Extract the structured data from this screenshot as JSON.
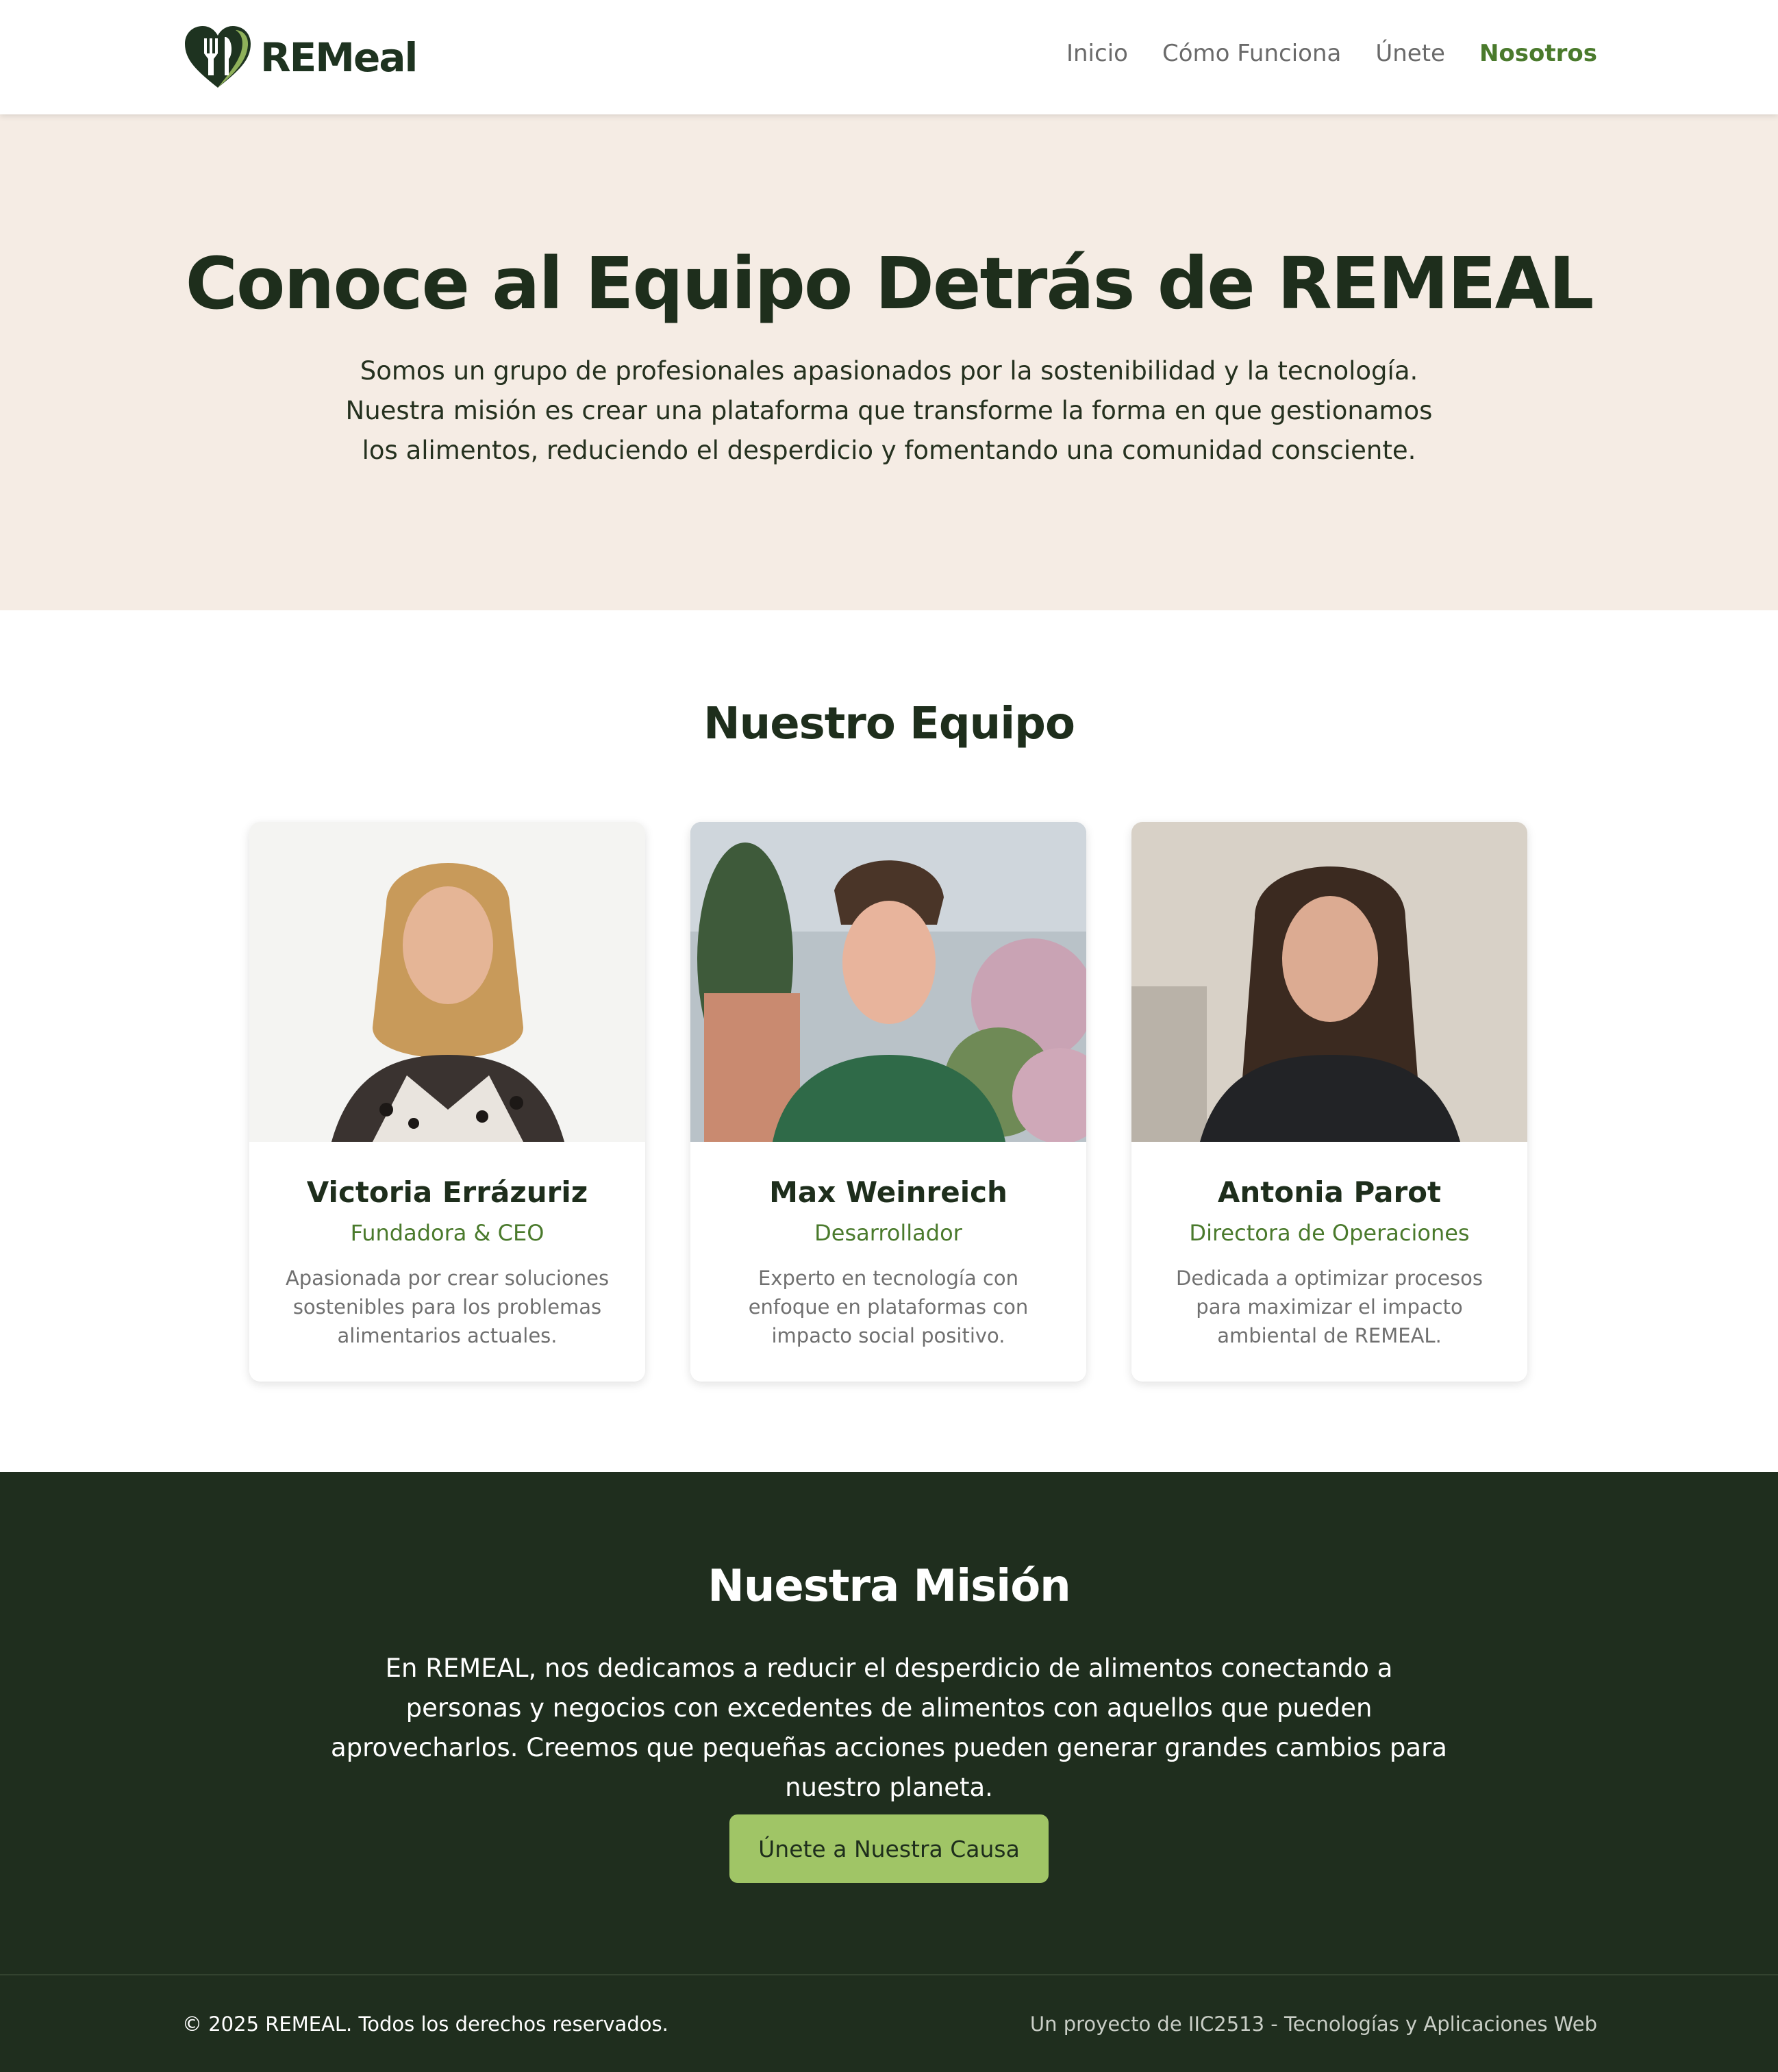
{
  "header": {
    "logo_text": "REMeal",
    "nav": [
      {
        "label": "Inicio"
      },
      {
        "label": "Cómo Funciona"
      },
      {
        "label": "Únete"
      },
      {
        "label": "Nosotros"
      }
    ],
    "active_nav": "Nosotros"
  },
  "hero": {
    "title": "Conoce al Equipo Detrás de REMEAL",
    "text": "Somos un grupo de profesionales apasionados por la sostenibilidad y la tecnología. Nuestra misión es crear una plataforma que transforme la forma en que gestionamos los alimentos, reduciendo el desperdicio y fomentando una comunidad consciente."
  },
  "team": {
    "title": "Nuestro Equipo",
    "members": [
      {
        "name": "Victoria Errázuriz",
        "role": "Fundadora & CEO",
        "description": "Apasionada por crear soluciones sostenibles para los problemas alimentarios actuales."
      },
      {
        "name": "Max Weinreich",
        "role": "Desarrollador",
        "description": "Experto en tecnología con enfoque en plataformas con impacto social positivo."
      },
      {
        "name": "Antonia Parot",
        "role": "Directora de Operaciones",
        "description": "Dedicada a optimizar procesos para maximizar el impacto ambiental de REMEAL."
      }
    ]
  },
  "mission": {
    "title": "Nuestra Misión",
    "text": "En REMEAL, nos dedicamos a reducir el desperdicio de alimentos conectando a personas y negocios con excedentes de alimentos con aquellos que pueden aprovecharlos. Creemos que pequeñas acciones pueden generar grandes cambios para nuestro planeta.",
    "cta_label": "Únete a Nuestra Causa"
  },
  "footer": {
    "copyright": "© 2025 REMEAL. Todos los derechos reservados.",
    "project": "Un proyecto de IIC2513 - Tecnologías y Aplicaciones Web"
  },
  "colors": {
    "brand_dark": "#1f2e1e",
    "brand_green": "#4a7a2c",
    "button_green": "#a0c566",
    "hero_bg": "#f5ece4"
  }
}
